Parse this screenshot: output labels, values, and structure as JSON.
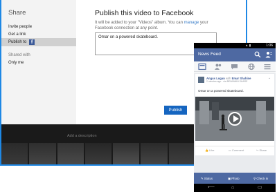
{
  "share_pane": {
    "heading": "Share",
    "items": [
      {
        "label": "Invite people"
      },
      {
        "label": "Get a link"
      },
      {
        "label": "Publish to",
        "badge": "f"
      }
    ],
    "shared_with_label": "Shared with",
    "shared_with_value": "Only me"
  },
  "publish_pane": {
    "title": "Publish this video to Facebook",
    "description_prefix": "It will be added to your \"Videos\" album. You can ",
    "description_link": "manage",
    "description_suffix": " your Facebook connection at any point.",
    "caption_value": "Omar on a powered skateboard.",
    "publish_button": "Publish"
  },
  "app_background": {
    "add_description": "Add a description"
  },
  "phone": {
    "status_time": "1:06",
    "header_title": "News Feed",
    "tabs": [
      "news-feed",
      "friend-requests",
      "messages",
      "notifications",
      "more"
    ],
    "post": {
      "author": "Angus Logan",
      "with_text": "with",
      "tagged": "Emar Shahine",
      "meta": "2 minutes ago · via BENJAMIN SHARE",
      "caption": "Omar on a powered skateboard."
    },
    "actions": {
      "like": "Like",
      "comment": "Comment",
      "share": "Share"
    },
    "composer": {
      "status": "Status",
      "photo": "Photo",
      "checkin": "Check in"
    },
    "nav": {
      "back": "⟵",
      "home": "⌂",
      "recents": "▭"
    }
  },
  "colors": {
    "accent_blue": "#1e88e5",
    "publish_button": "#1565c0",
    "facebook_blue": "#4e69a2"
  }
}
